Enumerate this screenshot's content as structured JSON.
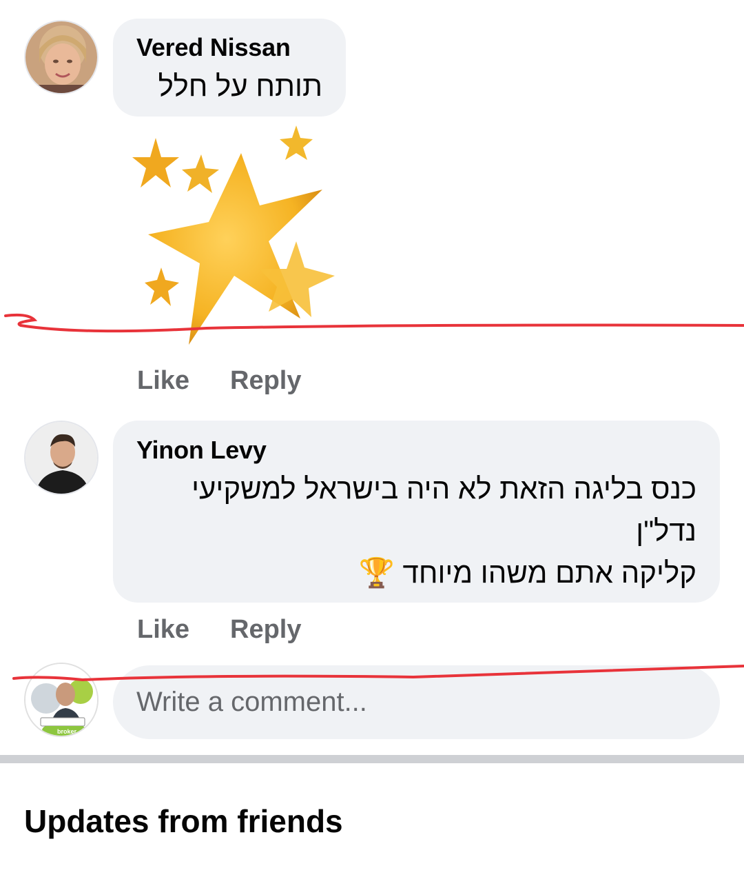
{
  "comments": [
    {
      "author": "Vered Nissan",
      "text": "תותח על חלל",
      "sticker": "stars-sticker",
      "actions": {
        "like": "Like",
        "reply": "Reply"
      }
    },
    {
      "author": "Yinon Levy",
      "lines": [
        "כנס בליגה הזאת לא היה בישראל למשקיעי",
        "נדל\"ן",
        "קליקה אתם משהו מיוחד"
      ],
      "emoji": "🏆",
      "actions": {
        "like": "Like",
        "reply": "Reply"
      }
    }
  ],
  "composer": {
    "placeholder": "Write a comment...",
    "avatar_badge": "broker"
  },
  "section": {
    "title": "Updates from friends"
  },
  "colors": {
    "bubble": "#f0f2f5",
    "action_text": "#65676b",
    "marker": "#e8333a",
    "star": "#f5b323"
  }
}
